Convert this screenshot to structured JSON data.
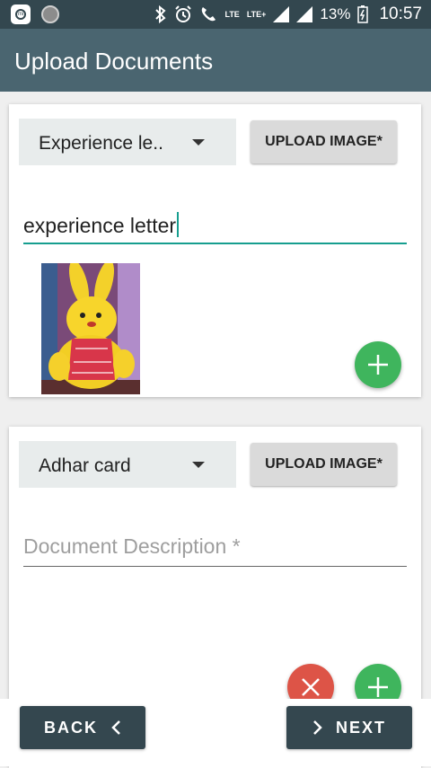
{
  "status_bar": {
    "network_label": "LTE",
    "network2_label": "LTE+",
    "battery_percent": "13%",
    "time": "10:57"
  },
  "app_bar": {
    "title": "Upload Documents"
  },
  "cards": [
    {
      "document_type": "Experience le..",
      "upload_label": "UPLOAD IMAGE*",
      "description_value": "experience letter",
      "description_placeholder": "Document Description *",
      "has_image": true
    },
    {
      "document_type": "Adhar card",
      "upload_label": "UPLOAD IMAGE*",
      "description_value": "",
      "description_placeholder": "Document Description *",
      "has_image": false
    }
  ],
  "bottom": {
    "back_label": "BACK",
    "next_label": "NEXT"
  },
  "colors": {
    "app_bar": "#4a6570",
    "status_bar": "#33474f",
    "accent": "#169e8f",
    "fab_add": "#3fb55d",
    "fab_remove": "#dd5447",
    "nav_button": "#34474f"
  },
  "icons": [
    "app-icon",
    "bluetooth-icon",
    "alarm-icon",
    "call-icon",
    "signal-icon",
    "battery-icon",
    "dropdown-caret-icon",
    "add-icon",
    "remove-icon",
    "chevron-left-icon",
    "chevron-right-icon"
  ]
}
